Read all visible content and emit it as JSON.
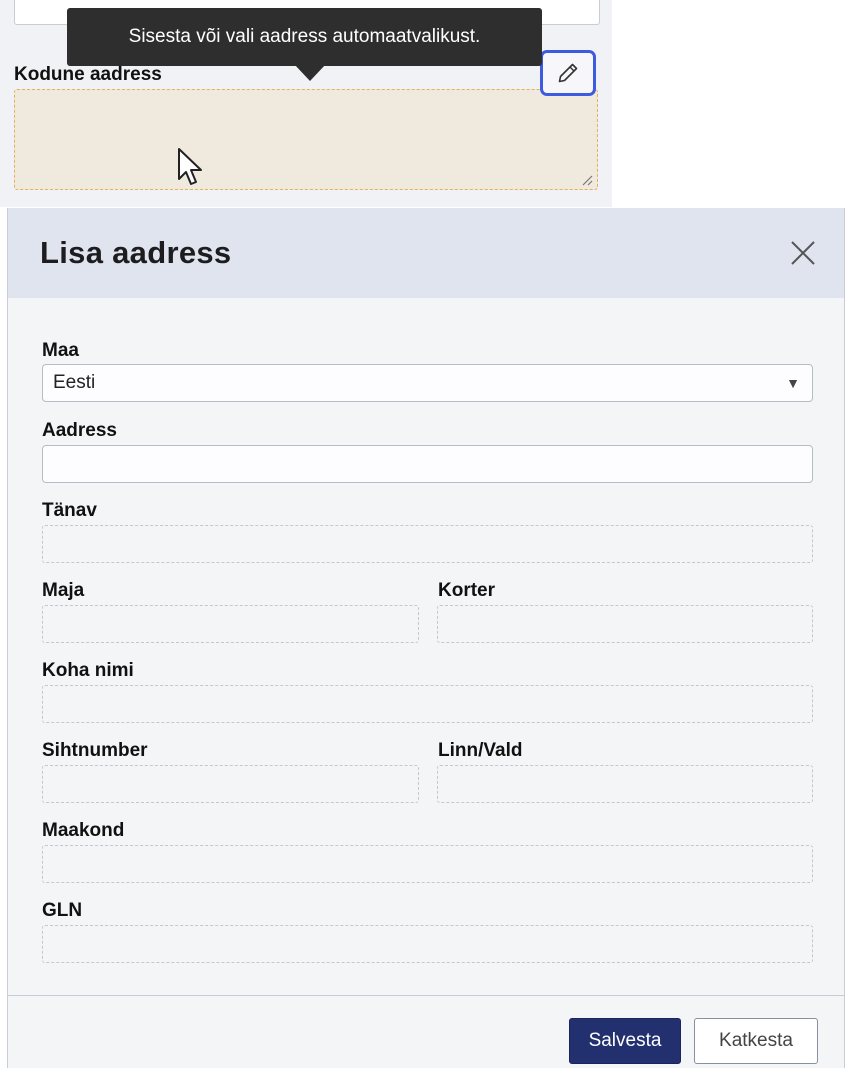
{
  "background_form": {
    "home_address_label": "Kodune aadress",
    "tooltip": "Sisesta või vali aadress automaatvalikust.",
    "edit_icon": "pencil-icon"
  },
  "modal": {
    "title": "Lisa aadress",
    "close_icon": "close-icon",
    "fields": {
      "country": {
        "label": "Maa",
        "value": "Eesti"
      },
      "address": {
        "label": "Aadress",
        "value": ""
      },
      "street": {
        "label": "Tänav"
      },
      "house": {
        "label": "Maja"
      },
      "apartment": {
        "label": "Korter"
      },
      "place_name": {
        "label": "Koha nimi"
      },
      "postal_code": {
        "label": "Sihtnumber"
      },
      "city": {
        "label": "Linn/Vald"
      },
      "county": {
        "label": "Maakond"
      },
      "gln": {
        "label": "GLN"
      }
    },
    "buttons": {
      "save": "Salvesta",
      "cancel": "Katkesta"
    }
  },
  "colors": {
    "accent": "#22306f",
    "focus_ring": "#3d5be0",
    "header_bg": "#dfe4ef",
    "textarea_bg": "#f0e9dd",
    "tooltip_bg": "#2e2e2e"
  }
}
